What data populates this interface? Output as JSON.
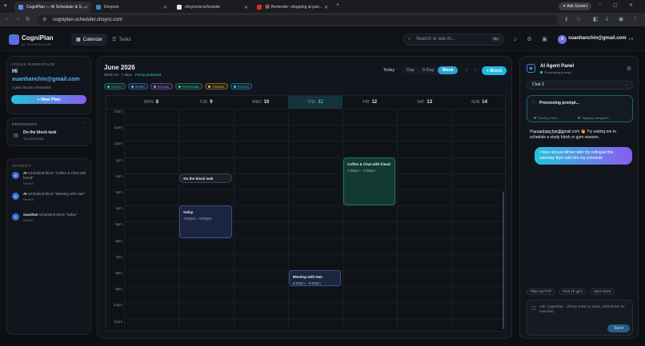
{
  "browser": {
    "tabs": [
      {
        "title": "CogniPlan — AI Scheduler & S...",
        "active": true,
        "color": "#5b8def"
      },
      {
        "title": "Devpost",
        "active": false,
        "color": "#3b82c4"
      },
      {
        "title": "shsync/ai-scheduler",
        "active": false,
        "color": "#e8e8e8"
      },
      {
        "title": "🐻 Reminder: shopping at pan...",
        "active": false,
        "color": "#d93025"
      }
    ],
    "url": "cogniplan-scheduler.shsync.com",
    "gemini": "Ask Gemini"
  },
  "app": {
    "logo_title": "CogniPlan",
    "logo_subtitle": "AI SCHEDULER",
    "nav": [
      {
        "label": "Calendar",
        "active": true
      },
      {
        "label": "Tasks",
        "active": false
      }
    ],
    "search_placeholder": "Search or ask AI...",
    "search_kbd": "⌘K",
    "user_initial": "X",
    "user_email": "xuanhanchin@gmail.com"
  },
  "sidebar": {
    "focus_label": "FOCUS WORKSPACE",
    "greeting": "Hi",
    "email": "xuanhanchin@gmail.com",
    "blocks_scheduled": "4 plan blocks scheduled",
    "new_plan": "+ New Plan",
    "reminders_label": "REMINDERS",
    "reminders_more": "···",
    "reminder": {
      "title": "Do the block task",
      "time": "Tue 02:00 PM"
    },
    "activity_label": "ACTIVITY",
    "activity": [
      {
        "actor": "AI",
        "text": " scheduled block \"Coffee & Chat with friend\"",
        "when": "Recent"
      },
      {
        "actor": "AI",
        "text": " scheduled block \"Meeting with Han\"",
        "when": "Recent"
      },
      {
        "actor": "xuanhan",
        "text": " scheduled block \"today\"",
        "when": "Recent"
      }
    ]
  },
  "calendar": {
    "title": "June 2026",
    "week_info": "Week 23 · 7 days · ",
    "focus_protected": "Focus protected",
    "tags": [
      {
        "label": "STUDY",
        "color": "#2dd4bf"
      },
      {
        "label": "WORK",
        "color": "#60a5fa"
      },
      {
        "label": "SOCIAL",
        "color": "#c084fc"
      },
      {
        "label": "PERSONAL",
        "color": "#34d399"
      },
      {
        "label": "TRAVEL",
        "color": "#fbbf24"
      },
      {
        "label": "FOCUS",
        "color": "#22d3ee"
      }
    ],
    "today_btn": "Today",
    "views": [
      {
        "label": "Day",
        "active": false
      },
      {
        "label": "3-Day",
        "active": false
      },
      {
        "label": "Week",
        "active": true
      }
    ],
    "block_btn": "+ Block",
    "days": [
      {
        "dow": "MON",
        "num": "8",
        "today": false
      },
      {
        "dow": "TUE",
        "num": "9",
        "today": false
      },
      {
        "dow": "WED",
        "num": "10",
        "today": false
      },
      {
        "dow": "THU",
        "num": "11",
        "today": true
      },
      {
        "dow": "FRI",
        "num": "12",
        "today": false
      },
      {
        "dow": "SAT",
        "num": "13",
        "today": false
      },
      {
        "dow": "SUN",
        "num": "14",
        "today": false
      }
    ],
    "hours": [
      "10am",
      "11am",
      "12pm",
      "1pm",
      "2pm",
      "3pm",
      "4pm",
      "5pm",
      "6pm",
      "7pm",
      "8pm",
      "9pm",
      "10pm",
      "11pm"
    ],
    "events": [
      {
        "title": "Do the block task",
        "time": "",
        "day": 1,
        "start": 14.0,
        "end": 14.6,
        "kind": "plain"
      },
      {
        "title": "Coffee & Chat with friend",
        "time": "1:00pm – 4:00pm",
        "day": 4,
        "start": 13.0,
        "end": 16.0,
        "kind": "green"
      },
      {
        "title": "today",
        "time": "4:00pm – 6:00pm",
        "day": 1,
        "start": 16.0,
        "end": 18.0,
        "kind": "blue"
      },
      {
        "title": "Meeting with Han",
        "time": "8:00pm – 9:00pm",
        "day": 3,
        "start": 20.0,
        "end": 21.0,
        "kind": "blue"
      }
    ]
  },
  "agent": {
    "title": "AI Agent Panel",
    "status": "Processing prompt...",
    "chat_select": "Chat 3",
    "processing_title": "Processing prompt...",
    "steps": [
      "Parsing intent...",
      "Tagging categories...",
      "Scanning free slots..."
    ],
    "assistant_msg": "Hi xuanhanchin@gmail.com 👋 Try asking me to schedule a study block or gym session.",
    "user_msg": "i have annual dinner with my collegue this saturday 8pm add into my schedule",
    "suggestions": [
      "Plan my FYP",
      "Find 1h gym",
      "Sync team"
    ],
    "input_placeholder": "Ask CogniPlan... (Press Enter to send, Shift+Enter for new line)",
    "send": "Send"
  }
}
